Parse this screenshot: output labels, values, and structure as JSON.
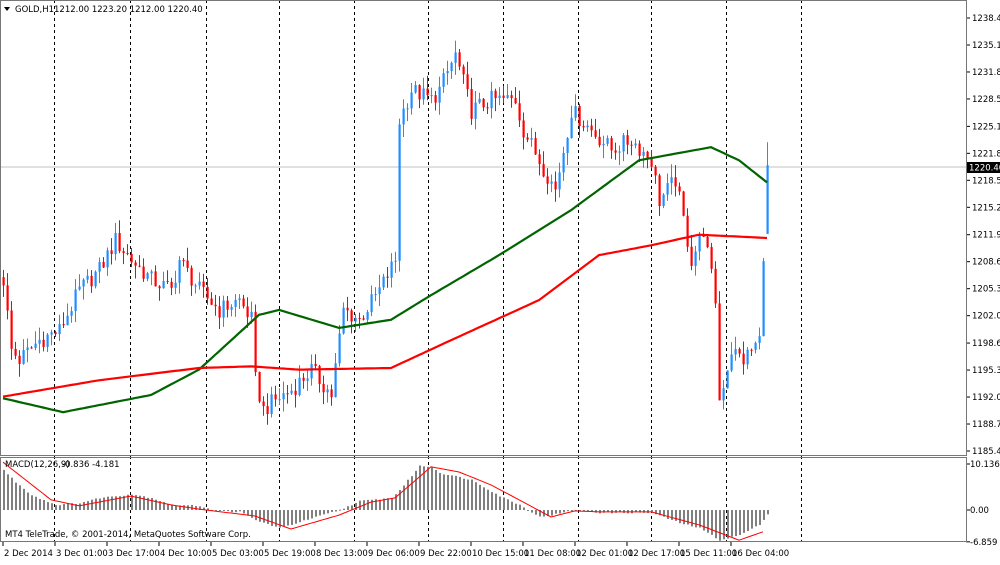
{
  "header": {
    "symbol": "GOLD,H1",
    "ohlc": "1212.00 1223.20 1212.00 1220.40"
  },
  "macd_label": {
    "name": "MACD(12,26,9)",
    "values": "-0.836 -4.181"
  },
  "copyright": "MT4 TeleTrade, © 2001-2014, MetaQuotes Software Corp.",
  "current_price": "1220.40",
  "colors": {
    "up": "#1e8fff",
    "down": "#ff0000",
    "ma_fast": "#006400",
    "ma_slow": "#ff0000",
    "histogram": "#808080",
    "signal": "#ff0000",
    "grid": "#000000"
  },
  "chart_data": [
    {
      "type": "candlestick",
      "title": "GOLD,H1",
      "ylim": [
        1185.45,
        1238.4
      ],
      "yticks": [
        "1238.40",
        "1235.10",
        "1231.80",
        "1228.50",
        "1225.15",
        "1221.85",
        "1218.55",
        "1215.25",
        "1211.90",
        "1208.60",
        "1205.30",
        "1202.00",
        "1198.65",
        "1195.35",
        "1192.05",
        "1188.75",
        "1185.45"
      ],
      "xticks": [
        "2 Dec 2014",
        "3 Dec 01:00",
        "3 Dec 17:00",
        "4 Dec 10:00",
        "5 Dec 03:00",
        "5 Dec 19:00",
        "8 Dec 13:00",
        "9 Dec 06:00",
        "9 Dec 22:00",
        "10 Dec 15:00",
        "11 Dec 08:00",
        "12 Dec 01:00",
        "12 Dec 17:00",
        "15 Dec 11:00",
        "16 Dec 04:00"
      ],
      "bar_count": 192,
      "close_path": [
        [
          0,
          1206.4
        ],
        [
          2,
          1197.8
        ],
        [
          4,
          1196.6
        ],
        [
          9,
          1199.0
        ],
        [
          14,
          1200.2
        ],
        [
          19,
          1205.1
        ],
        [
          24,
          1207.6
        ],
        [
          28,
          1211.2
        ],
        [
          32,
          1208.8
        ],
        [
          37,
          1206.4
        ],
        [
          42,
          1205.1
        ],
        [
          44,
          1208.8
        ],
        [
          49,
          1205.1
        ],
        [
          54,
          1202.7
        ],
        [
          59,
          1203.9
        ],
        [
          62,
          1201.5
        ],
        [
          63,
          1194.1
        ],
        [
          65,
          1190.5
        ],
        [
          68,
          1191.7
        ],
        [
          72,
          1192.9
        ],
        [
          77,
          1195.4
        ],
        [
          82,
          1192.3
        ],
        [
          85,
          1202.7
        ],
        [
          89,
          1201.5
        ],
        [
          94,
          1205.1
        ],
        [
          98,
          1208.8
        ],
        [
          99,
          1225.9
        ],
        [
          102,
          1229.6
        ],
        [
          107,
          1228.4
        ],
        [
          109,
          1229.6
        ],
        [
          113,
          1233.9
        ],
        [
          117,
          1227.1
        ],
        [
          122,
          1228.4
        ],
        [
          128,
          1228.4
        ],
        [
          130,
          1224.7
        ],
        [
          134,
          1221.0
        ],
        [
          138,
          1217.4
        ],
        [
          142,
          1227.1
        ],
        [
          147,
          1224.7
        ],
        [
          152,
          1222.3
        ],
        [
          157,
          1223.5
        ],
        [
          162,
          1221.0
        ],
        [
          164,
          1216.1
        ],
        [
          168,
          1218.6
        ],
        [
          172,
          1208.8
        ],
        [
          175,
          1212.5
        ],
        [
          178,
          1203.9
        ],
        [
          179,
          1191.7
        ],
        [
          182,
          1197.8
        ],
        [
          185,
          1196.6
        ],
        [
          189,
          1199.0
        ],
        [
          191,
          1220.4
        ]
      ],
      "last_bar": {
        "open": 1212.0,
        "high": 1223.2,
        "low": 1212.0,
        "close": 1220.4
      },
      "series": [
        {
          "name": "MA fast (green)",
          "points": [
            [
              0,
              1191.9
            ],
            [
              15,
              1190.2
            ],
            [
              37,
              1192.3
            ],
            [
              49,
              1195.4
            ],
            [
              64,
              1202.1
            ],
            [
              69,
              1202.7
            ],
            [
              84,
              1200.5
            ],
            [
              97,
              1201.5
            ],
            [
              107,
              1204.5
            ],
            [
              124,
              1209.4
            ],
            [
              142,
              1214.9
            ],
            [
              159,
              1221.0
            ],
            [
              177,
              1222.6
            ],
            [
              184,
              1221.0
            ],
            [
              191,
              1218.3
            ]
          ]
        },
        {
          "name": "MA slow (red)",
          "points": [
            [
              0,
              1192.1
            ],
            [
              24,
              1194.1
            ],
            [
              49,
              1195.6
            ],
            [
              62,
              1195.8
            ],
            [
              74,
              1195.4
            ],
            [
              97,
              1195.6
            ],
            [
              112,
              1199.0
            ],
            [
              134,
              1203.9
            ],
            [
              149,
              1209.4
            ],
            [
              162,
              1210.6
            ],
            [
              174,
              1211.9
            ],
            [
              191,
              1211.5
            ]
          ]
        }
      ]
    },
    {
      "type": "bar",
      "title": "MACD(12,26,9)",
      "ylim": [
        -6.859,
        10.136
      ],
      "yticks": [
        "10.136",
        "0.00",
        "-6.859"
      ],
      "histogram": [
        [
          0,
          8.6
        ],
        [
          3,
          6.0
        ],
        [
          7,
          3.2
        ],
        [
          13,
          1.1
        ],
        [
          19,
          1.5
        ],
        [
          24,
          2.6
        ],
        [
          32,
          3.4
        ],
        [
          37,
          2.6
        ],
        [
          42,
          1.1
        ],
        [
          49,
          0.9
        ],
        [
          53,
          -0.2
        ],
        [
          59,
          -0.4
        ],
        [
          63,
          -2.2
        ],
        [
          69,
          -3.9
        ],
        [
          74,
          -2.6
        ],
        [
          84,
          0
        ],
        [
          89,
          1.9
        ],
        [
          97,
          2.6
        ],
        [
          99,
          4.3
        ],
        [
          104,
          9.5
        ],
        [
          107,
          9.3
        ],
        [
          109,
          8.0
        ],
        [
          117,
          6.5
        ],
        [
          124,
          3.0
        ],
        [
          129,
          1.1
        ],
        [
          134,
          -1.5
        ],
        [
          137,
          -1.1
        ],
        [
          143,
          0
        ],
        [
          149,
          -0.6
        ],
        [
          162,
          -0.6
        ],
        [
          169,
          -2.8
        ],
        [
          174,
          -3.9
        ],
        [
          179,
          -6.5
        ],
        [
          184,
          -5.4
        ],
        [
          189,
          -3.2
        ],
        [
          191,
          -0.8
        ]
      ],
      "signal": [
        [
          0,
          10.3
        ],
        [
          12,
          2.2
        ],
        [
          19,
          0.9
        ],
        [
          32,
          3.0
        ],
        [
          42,
          1.1
        ],
        [
          49,
          0.2
        ],
        [
          63,
          -1.3
        ],
        [
          72,
          -4.1
        ],
        [
          84,
          -1.1
        ],
        [
          92,
          1.7
        ],
        [
          98,
          2.6
        ],
        [
          107,
          9.3
        ],
        [
          114,
          8.2
        ],
        [
          122,
          5.4
        ],
        [
          129,
          2.2
        ],
        [
          137,
          -1.5
        ],
        [
          143,
          -0.2
        ],
        [
          149,
          -0.4
        ],
        [
          162,
          -0.4
        ],
        [
          174,
          -3.2
        ],
        [
          184,
          -6.5
        ],
        [
          190,
          -4.7
        ]
      ]
    }
  ]
}
